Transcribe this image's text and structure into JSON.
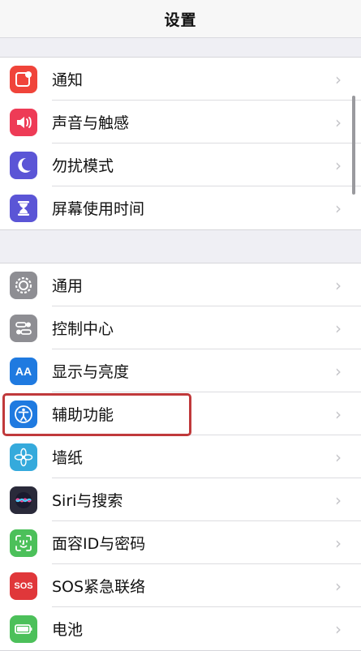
{
  "header": {
    "title": "设置"
  },
  "group1": {
    "items": [
      {
        "label": "通知",
        "icon": "notifications-icon",
        "color": "#f0443a"
      },
      {
        "label": "声音与触感",
        "icon": "sound-icon",
        "color": "#ee3b56"
      },
      {
        "label": "勿扰模式",
        "icon": "moon-icon",
        "color": "#5b55d6"
      },
      {
        "label": "屏幕使用时间",
        "icon": "hourglass-icon",
        "color": "#5b55d6"
      }
    ]
  },
  "group2": {
    "items": [
      {
        "label": "通用",
        "icon": "gear-icon",
        "color": "#8e8e93"
      },
      {
        "label": "控制中心",
        "icon": "toggles-icon",
        "color": "#8e8e93"
      },
      {
        "label": "显示与亮度",
        "icon": "aa-icon",
        "color": "#1f7ae0",
        "icon_text": "AA"
      },
      {
        "label": "辅助功能",
        "icon": "accessibility-icon",
        "color": "#1f7ae0"
      },
      {
        "label": "墙纸",
        "icon": "flower-icon",
        "color": "#35aadc"
      },
      {
        "label": "Siri与搜索",
        "icon": "siri-icon",
        "color": "#2a2a3a"
      },
      {
        "label": "面容ID与密码",
        "icon": "face-id-icon",
        "color": "#4cc05a"
      },
      {
        "label": "SOS紧急联络",
        "icon": "sos-icon",
        "color": "#e0373a",
        "icon_text": "SOS"
      },
      {
        "label": "电池",
        "icon": "battery-icon",
        "color": "#4cc05a"
      }
    ]
  },
  "highlighted_item": "辅助功能",
  "colors": {
    "chevron": "#c4c4c8",
    "highlight": "#c0393b",
    "background": "#efeff4"
  }
}
